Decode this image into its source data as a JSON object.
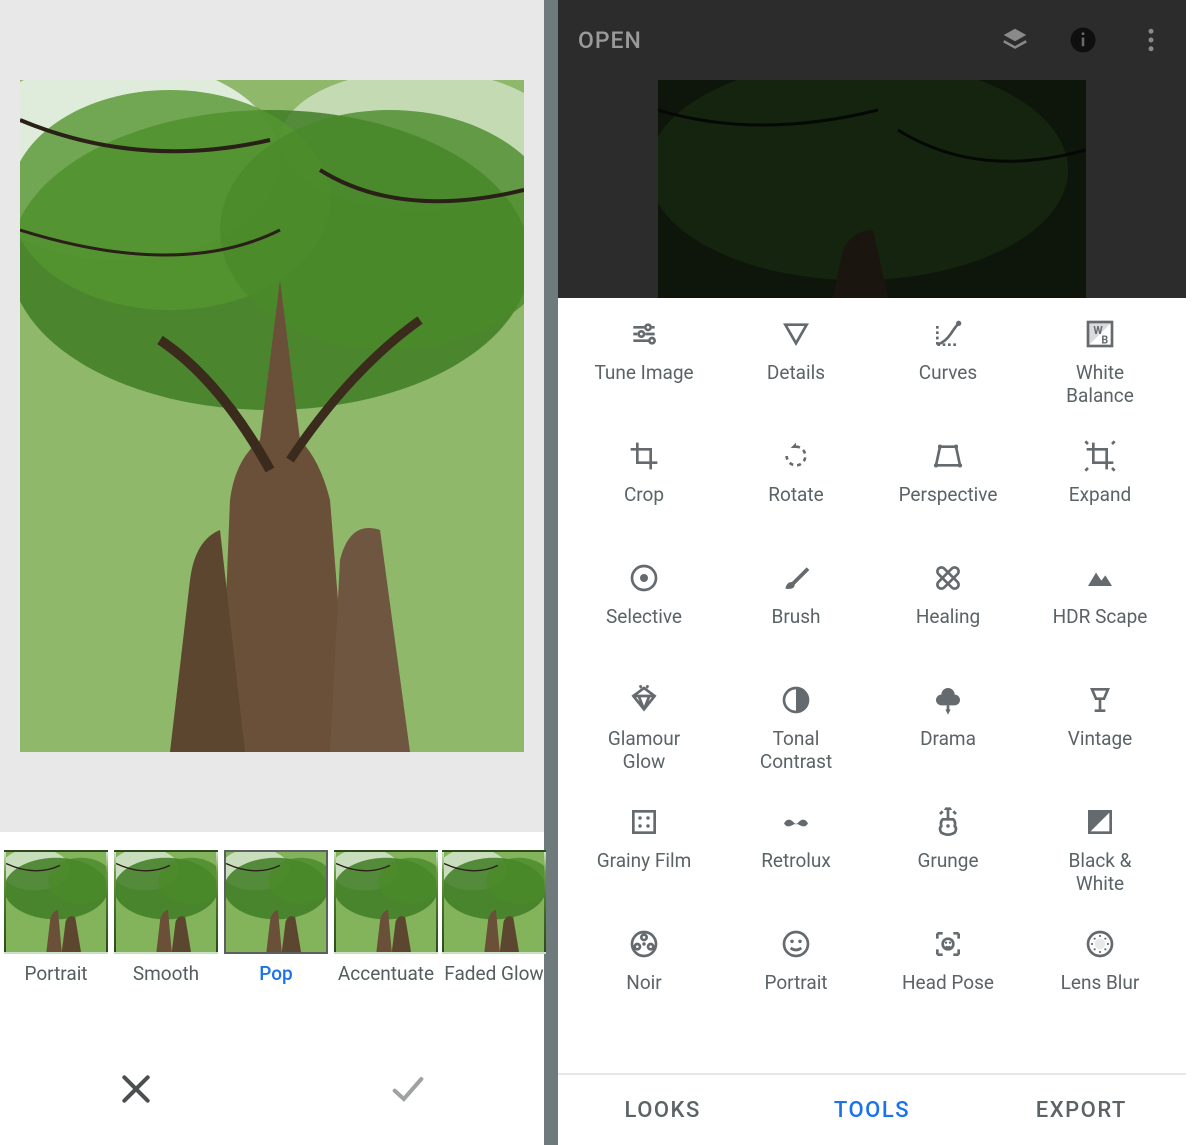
{
  "left": {
    "filters": [
      {
        "label": "Portrait",
        "selected": false
      },
      {
        "label": "Smooth",
        "selected": false
      },
      {
        "label": "Pop",
        "selected": true
      },
      {
        "label": "Accentuate",
        "selected": false
      },
      {
        "label": "Faded Glow",
        "selected": false
      }
    ],
    "actions": {
      "cancel": "Cancel",
      "confirm": "Confirm"
    }
  },
  "right": {
    "topbar": {
      "open_label": "OPEN",
      "icons": [
        "layers-icon",
        "info-icon",
        "more-icon"
      ]
    },
    "tools": [
      {
        "name": "tune-image",
        "label": "Tune Image",
        "icon": "sliders-icon"
      },
      {
        "name": "details",
        "label": "Details",
        "icon": "triangle-down-icon"
      },
      {
        "name": "curves",
        "label": "Curves",
        "icon": "curves-icon"
      },
      {
        "name": "white-balance",
        "label": "White Balance",
        "icon": "wb-icon"
      },
      {
        "name": "crop",
        "label": "Crop",
        "icon": "crop-icon"
      },
      {
        "name": "rotate",
        "label": "Rotate",
        "icon": "rotate-icon"
      },
      {
        "name": "perspective",
        "label": "Perspective",
        "icon": "perspective-icon"
      },
      {
        "name": "expand",
        "label": "Expand",
        "icon": "expand-icon"
      },
      {
        "name": "selective",
        "label": "Selective",
        "icon": "target-icon"
      },
      {
        "name": "brush",
        "label": "Brush",
        "icon": "brush-icon"
      },
      {
        "name": "healing",
        "label": "Healing",
        "icon": "bandage-icon"
      },
      {
        "name": "hdr-scape",
        "label": "HDR Scape",
        "icon": "mountain-icon"
      },
      {
        "name": "glamour-glow",
        "label": "Glamour Glow",
        "icon": "diamond-icon"
      },
      {
        "name": "tonal-contrast",
        "label": "Tonal Contrast",
        "icon": "tonal-icon"
      },
      {
        "name": "drama",
        "label": "Drama",
        "icon": "cloud-icon"
      },
      {
        "name": "vintage",
        "label": "Vintage",
        "icon": "lamp-icon"
      },
      {
        "name": "grainy-film",
        "label": "Grainy Film",
        "icon": "filmframe-icon"
      },
      {
        "name": "retrolux",
        "label": "Retrolux",
        "icon": "mustache-icon"
      },
      {
        "name": "grunge",
        "label": "Grunge",
        "icon": "guitar-icon"
      },
      {
        "name": "black-white",
        "label": "Black & White",
        "icon": "bw-icon"
      },
      {
        "name": "noir",
        "label": "Noir",
        "icon": "reel-icon"
      },
      {
        "name": "portrait",
        "label": "Portrait",
        "icon": "face-icon"
      },
      {
        "name": "head-pose",
        "label": "Head Pose",
        "icon": "headpose-icon"
      },
      {
        "name": "lens-blur",
        "label": "Lens Blur",
        "icon": "aperture-icon"
      }
    ],
    "tabs": {
      "looks": "LOOKS",
      "tools": "TOOLS",
      "export": "EXPORT",
      "active": "tools"
    }
  }
}
